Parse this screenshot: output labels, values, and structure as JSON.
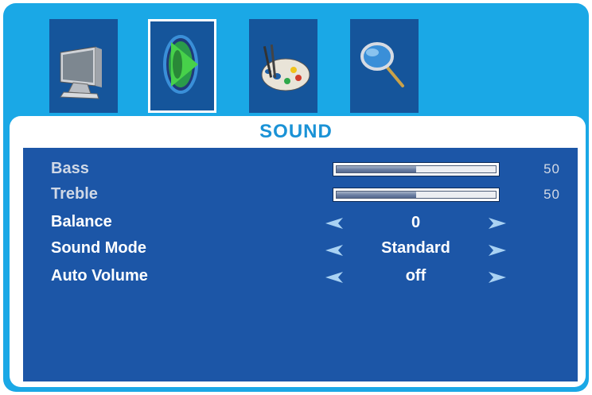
{
  "menu": {
    "tabs": [
      {
        "icon": "monitor-icon",
        "selected": false
      },
      {
        "icon": "sound-speaker-icon",
        "selected": true
      },
      {
        "icon": "palette-icon",
        "selected": false
      },
      {
        "icon": "magnifier-icon",
        "selected": false
      }
    ]
  },
  "panel": {
    "title": "SOUND",
    "sliders": [
      {
        "label": "Bass",
        "value": "50",
        "level": 0.5
      },
      {
        "label": "Treble",
        "value": "50",
        "level": 0.5
      }
    ],
    "options": [
      {
        "label": "Balance",
        "value": "0"
      },
      {
        "label": "Sound Mode",
        "value": "Standard"
      },
      {
        "label": "Auto Volume",
        "value": "off"
      }
    ]
  },
  "colors": {
    "frame": "#1aa8e6",
    "content": "#1c56a7",
    "tab": "#15559b",
    "title": "#1a92d6"
  }
}
